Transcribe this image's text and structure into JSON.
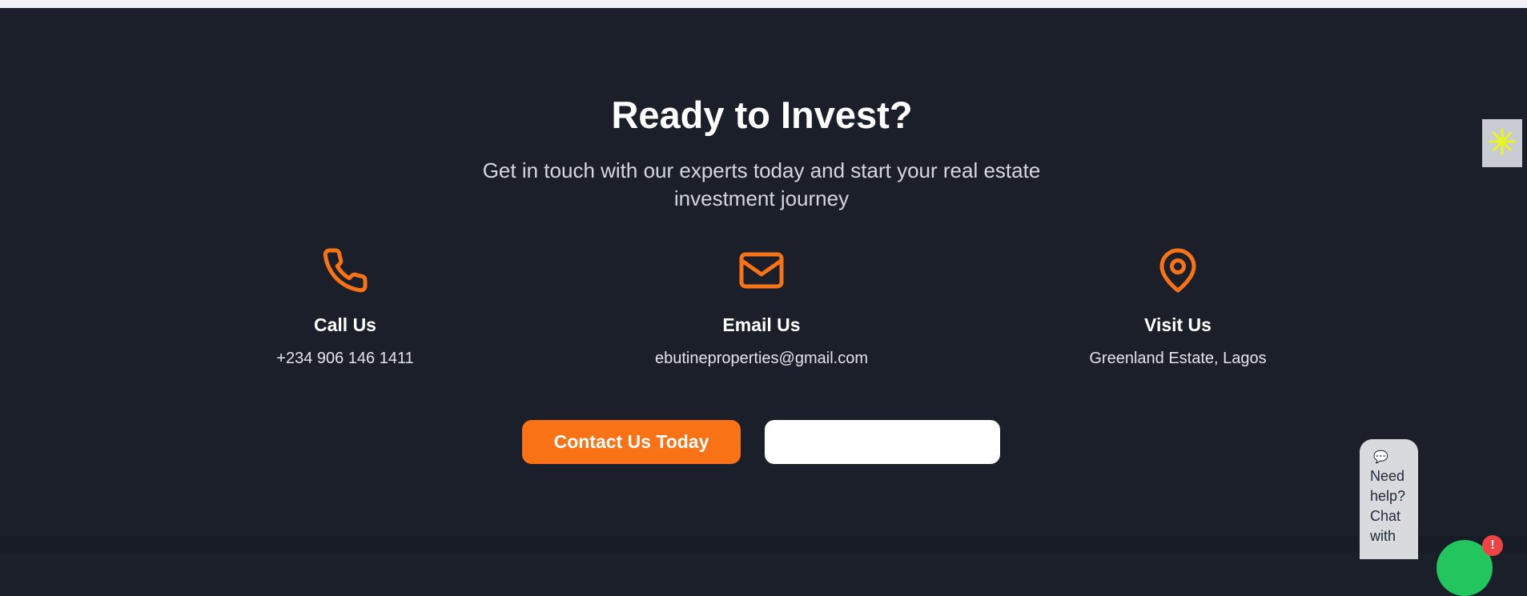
{
  "cta": {
    "title": "Ready to Invest?",
    "subtitle": "Get in touch with our experts today and start your real estate investment journey"
  },
  "contacts": [
    {
      "icon": "phone-icon",
      "heading": "Call Us",
      "value": "+234 906 146 1411"
    },
    {
      "icon": "mail-icon",
      "heading": "Email Us",
      "value": "ebutineproperties@gmail.com"
    },
    {
      "icon": "map-pin-icon",
      "heading": "Visit Us",
      "value": "Greenland Estate, Lagos"
    }
  ],
  "buttons": {
    "contact_label": "Contact Us Today",
    "secondary_label": ""
  },
  "chat_widget": {
    "icon": "speech-bubble-icon",
    "text": "Need\nhelp?\nChat\nwith",
    "badge": "!"
  },
  "side_widget": {
    "icon": "asterisk-icon"
  },
  "colors": {
    "background": "#1b1f2a",
    "accent": "#f97316",
    "text": "#ffffff",
    "muted": "#d4d7df",
    "chat_green": "#22c55e",
    "badge_red": "#ef4444"
  }
}
